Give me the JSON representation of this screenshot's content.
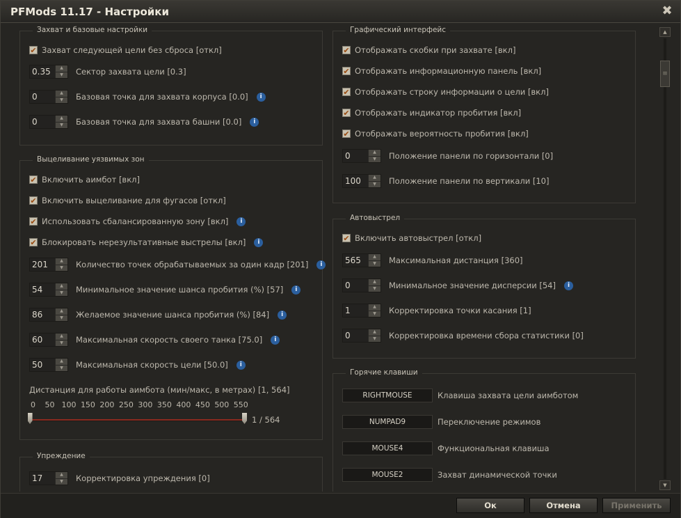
{
  "window": {
    "title": "PFMods 11.17 - Настройки",
    "close_glyph": "✖"
  },
  "groups": {
    "capture": {
      "title": "Захват и базовые настройки",
      "items": [
        {
          "type": "checkbox",
          "checked": true,
          "label": "Захват следующей цели без сброса [откл]"
        },
        {
          "type": "stepper",
          "value": "0.35",
          "label": "Сектор захвата цели [0.3]",
          "info": false
        },
        {
          "type": "stepper",
          "value": "0",
          "label": "Базовая точка для захвата корпуса [0.0]",
          "info": true
        },
        {
          "type": "stepper",
          "value": "0",
          "label": "Базовая точка для захвата башни [0.0]",
          "info": true
        }
      ]
    },
    "aim": {
      "title": "Выцеливание уязвимых зон",
      "items": [
        {
          "type": "checkbox",
          "checked": true,
          "label": "Включить аимбот [вкл]",
          "info": false
        },
        {
          "type": "checkbox",
          "checked": true,
          "label": "Включить выцеливание для фугасов [откл]",
          "info": false
        },
        {
          "type": "checkbox",
          "checked": true,
          "label": "Использовать сбалансированную зону [вкл]",
          "info": true
        },
        {
          "type": "checkbox",
          "checked": true,
          "label": "Блокировать нерезультативные выстрелы [вкл]",
          "info": true
        },
        {
          "type": "stepper",
          "value": "201",
          "label": "Количество точек обрабатываемых за один кадр [201]",
          "info": true
        },
        {
          "type": "stepper",
          "value": "54",
          "label": "Минимальное значение шанса пробития (%) [57]",
          "info": true
        },
        {
          "type": "stepper",
          "value": "86",
          "label": "Желаемое значение шанса пробития (%) [84]",
          "info": true
        },
        {
          "type": "stepper",
          "value": "60",
          "label": "Максимальная скорость своего танка [75.0]",
          "info": true
        },
        {
          "type": "stepper",
          "value": "50",
          "label": "Максимальная скорость цели [50.0]",
          "info": true
        }
      ],
      "range": {
        "label": "Дистанция для работы аимбота (мин/макс, в метрах) [1, 564]",
        "ticks": [
          "0",
          "50",
          "100",
          "150",
          "200",
          "250",
          "300",
          "350",
          "400",
          "450",
          "500",
          "550"
        ],
        "min": 1,
        "max": 564,
        "scale_max": 564,
        "readout": "1 / 564"
      }
    },
    "lead": {
      "title": "Упреждение",
      "items": [
        {
          "type": "stepper",
          "value": "17",
          "label": "Корректировка упреждения [0]",
          "info": false
        }
      ]
    },
    "gui": {
      "title": "Графический интерфейс",
      "items": [
        {
          "type": "checkbox",
          "checked": true,
          "label": "Отображать скобки при захвате [вкл]"
        },
        {
          "type": "checkbox",
          "checked": true,
          "label": "Отображать информационную панель [вкл]"
        },
        {
          "type": "checkbox",
          "checked": true,
          "label": "Отображать строку информации о цели [вкл]"
        },
        {
          "type": "checkbox",
          "checked": true,
          "label": "Отображать индикатор пробития [вкл]"
        },
        {
          "type": "checkbox",
          "checked": true,
          "label": "Отображать вероятность пробития [вкл]"
        },
        {
          "type": "stepper",
          "value": "0",
          "label": "Положение панели по горизонтали [0]",
          "info": false
        },
        {
          "type": "stepper",
          "value": "100",
          "label": "Положение панели по вертикали [10]",
          "info": false
        }
      ]
    },
    "autofire": {
      "title": "Автовыстрел",
      "items": [
        {
          "type": "checkbox",
          "checked": true,
          "label": "Включить автовыстрел [откл]",
          "info": false
        },
        {
          "type": "stepper",
          "value": "565",
          "label": "Максимальная дистанция [360]",
          "info": false
        },
        {
          "type": "stepper",
          "value": "0",
          "label": "Минимальное значение дисперсии [54]",
          "info": true
        },
        {
          "type": "stepper",
          "value": "1",
          "label": "Корректировка точки касания [1]",
          "info": false
        },
        {
          "type": "stepper",
          "value": "0",
          "label": "Корректировка времени сбора статистики [0]",
          "info": false
        }
      ]
    },
    "hotkeys": {
      "title": "Горячие клавиши",
      "items": [
        {
          "key": "RIGHTMOUSE",
          "label": "Клавиша захвата цели аимботом"
        },
        {
          "key": "NUMPAD9",
          "label": "Переключение режимов"
        },
        {
          "key": "MOUSE4",
          "label": "Функциональная клавиша"
        },
        {
          "key": "MOUSE2",
          "label": "Захват динамической точки"
        }
      ]
    }
  },
  "icons": {
    "check": "✔",
    "info": "i",
    "up": "▲",
    "down": "▼",
    "grip": "≡"
  },
  "colors": {
    "accent": "#9a4b11",
    "info": "#2b5f9e",
    "slider": "#8a2a1f"
  },
  "footer": {
    "ok": "Ок",
    "cancel": "Отмена",
    "apply": "Применить"
  }
}
